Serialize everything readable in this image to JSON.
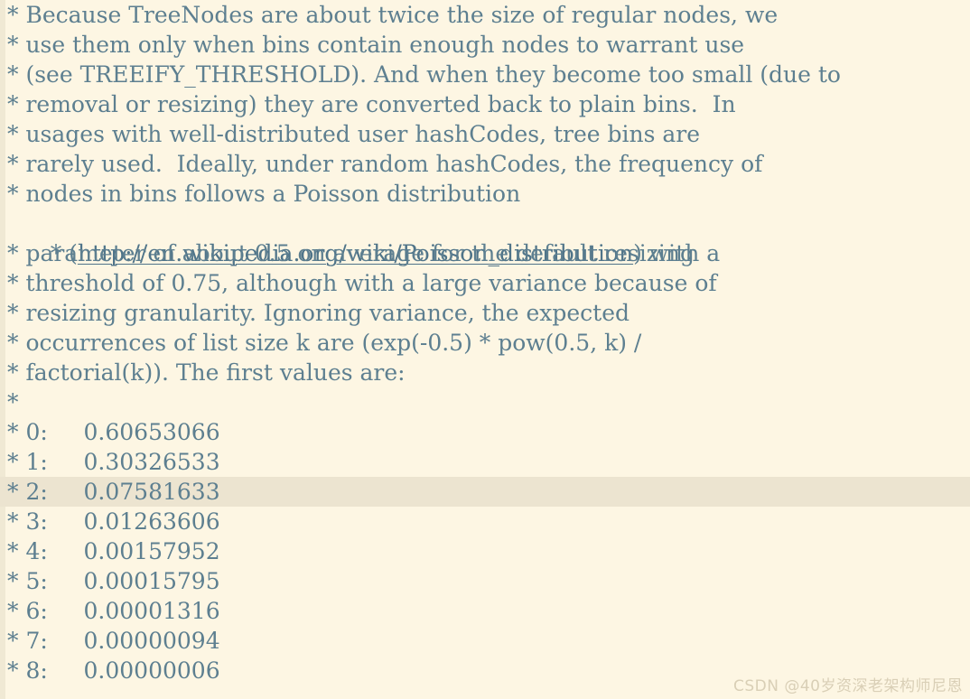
{
  "editor": {
    "theme_name": "solarized-light",
    "colors": {
      "background": "#fdf6e3",
      "text": "#5d7f90",
      "current_line_highlight": "#ece4d0",
      "gutter_strip": "#f0e9d4",
      "link": "#4f7489",
      "watermark": "#d9cfb6"
    },
    "current_line_index": 16,
    "font_size_px": 25,
    "line_height_px": 33
  },
  "code": {
    "language": "java",
    "comment_block": [
      {
        "prefix": "*",
        "text": " Because TreeNodes are about twice the size of regular nodes, we"
      },
      {
        "prefix": "*",
        "text": " use them only when bins contain enough nodes to warrant use"
      },
      {
        "prefix": "*",
        "text": " (see TREEIFY_THRESHOLD). And when they become too small (due to"
      },
      {
        "prefix": "*",
        "text": " removal or resizing) they are converted back to plain bins.  In"
      },
      {
        "prefix": "*",
        "text": " usages with well-distributed user hashCodes, tree bins are"
      },
      {
        "prefix": "*",
        "text": " rarely used.  Ideally, under random hashCodes, the frequency of"
      },
      {
        "prefix": "*",
        "text": " nodes in bins follows a Poisson distribution"
      },
      {
        "prefix": "*",
        "text": " (",
        "link": "http://en.wikipedia.org/wiki/Poisson_distribution",
        "text_after": ") with a"
      },
      {
        "prefix": "*",
        "text": " parameter of about 0.5 on average for the default resizing"
      },
      {
        "prefix": "*",
        "text": " threshold of 0.75, although with a large variance because of"
      },
      {
        "prefix": "*",
        "text": " resizing granularity. Ignoring variance, the expected"
      },
      {
        "prefix": "*",
        "text": " occurrences of list size k are (exp(-0.5) * pow(0.5, k) /"
      },
      {
        "prefix": "*",
        "text": " factorial(k)). The first values are:"
      },
      {
        "prefix": "*",
        "text": ""
      }
    ],
    "poisson_table": [
      {
        "prefix": "*",
        "k": "0:",
        "value": "0.60653066"
      },
      {
        "prefix": "*",
        "k": "1:",
        "value": "0.30326533"
      },
      {
        "prefix": "*",
        "k": "2:",
        "value": "0.07581633"
      },
      {
        "prefix": "*",
        "k": "3:",
        "value": "0.01263606"
      },
      {
        "prefix": "*",
        "k": "4:",
        "value": "0.00157952"
      },
      {
        "prefix": "*",
        "k": "5:",
        "value": "0.00015795"
      },
      {
        "prefix": "*",
        "k": "6:",
        "value": "0.00001316"
      },
      {
        "prefix": "*",
        "k": "7:",
        "value": "0.00000094"
      },
      {
        "prefix": "*",
        "k": "8:",
        "value": "0.00000006"
      }
    ],
    "rendered_lines": [
      "* Because TreeNodes are about twice the size of regular nodes, we",
      "* use them only when bins contain enough nodes to warrant use",
      "* (see TREEIFY_THRESHOLD). And when they become too small (due to",
      "* removal or resizing) they are converted back to plain bins.  In",
      "* usages with well-distributed user hashCodes, tree bins are",
      "* rarely used.  Ideally, under random hashCodes, the frequency of",
      "* nodes in bins follows a Poisson distribution",
      "* (http://en.wikipedia.org/wiki/Poisson_distribution) with a",
      "* parameter of about 0.5 on average for the default resizing",
      "* threshold of 0.75, although with a large variance because of",
      "* resizing granularity. Ignoring variance, the expected",
      "* occurrences of list size k are (exp(-0.5) * pow(0.5, k) /",
      "* factorial(k)). The first values are:",
      "*",
      "* 0:     0.60653066",
      "* 1:     0.30326533",
      "* 2:     0.07581633",
      "* 3:     0.01263606",
      "* 4:     0.00157952",
      "* 5:     0.00015795",
      "* 6:     0.00001316",
      "* 7:     0.00000094",
      "* 8:     0.00000006"
    ]
  },
  "watermark": {
    "text": "CSDN @40岁资深老架构师尼恩"
  }
}
